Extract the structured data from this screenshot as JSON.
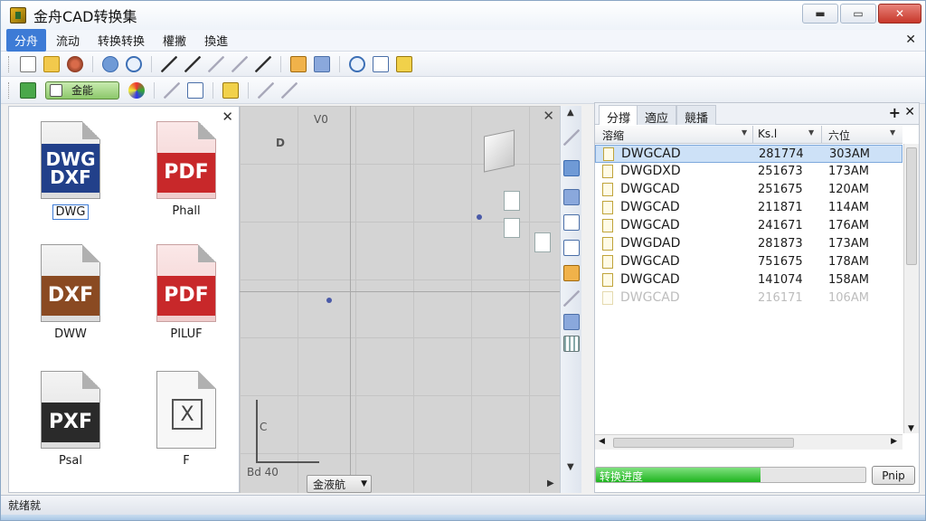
{
  "window": {
    "title": "金舟CAD转换集",
    "controls": {
      "minimize": "▬",
      "maximize": "▭",
      "close": "✕"
    }
  },
  "menu": {
    "items": [
      "分舟",
      "流动",
      "转换转换",
      "權撇",
      "換進"
    ],
    "close": "✕"
  },
  "toolbar2": {
    "combo_label": "金能"
  },
  "formats": [
    {
      "badge": [
        "DWG",
        "DXF"
      ],
      "caption": "DWG",
      "selected": true
    },
    {
      "badge": [
        "PDF"
      ],
      "caption": "Phall"
    },
    {
      "badge": [
        "DXF"
      ],
      "caption": "DWW"
    },
    {
      "badge": [
        "PDF"
      ],
      "caption": "PILUF"
    },
    {
      "badge": [
        "PXF"
      ],
      "caption": "Psal"
    },
    {
      "badge": [
        "X"
      ],
      "caption": "F"
    }
  ],
  "canvas": {
    "top_label": "V0",
    "side_letter": "D",
    "axis_label": "C",
    "coord_label": "Bd 40",
    "mode_combo": "金液航"
  },
  "right_panel": {
    "tabs": [
      "分撐",
      "適应",
      "競播"
    ],
    "columns": [
      "溶缩",
      "Ks.l",
      "六位"
    ],
    "files": [
      {
        "name": "DWGCAD",
        "size": "281774",
        "time": "303AM",
        "selected": true
      },
      {
        "name": "DWGDXD",
        "size": "251673",
        "time": "173AM"
      },
      {
        "name": "DWGCAD",
        "size": "251675",
        "time": "120AM"
      },
      {
        "name": "DWGCAD",
        "size": "211871",
        "time": "114AM"
      },
      {
        "name": "DWGCAD",
        "size": "241671",
        "time": "176AM"
      },
      {
        "name": "DWGDAD",
        "size": "281873",
        "time": "173AM"
      },
      {
        "name": "DWGCAD",
        "size": "751675",
        "time": "178AM"
      },
      {
        "name": "DWGCAD",
        "size": "141074",
        "time": "158AM"
      },
      {
        "name": "DWGCAD",
        "size": "216171",
        "time": "106AM",
        "faded": true
      }
    ],
    "progress": {
      "label": "转换进度",
      "value": 0.61
    },
    "progress_button": "Pnip"
  },
  "status": {
    "text": "就绪就"
  }
}
